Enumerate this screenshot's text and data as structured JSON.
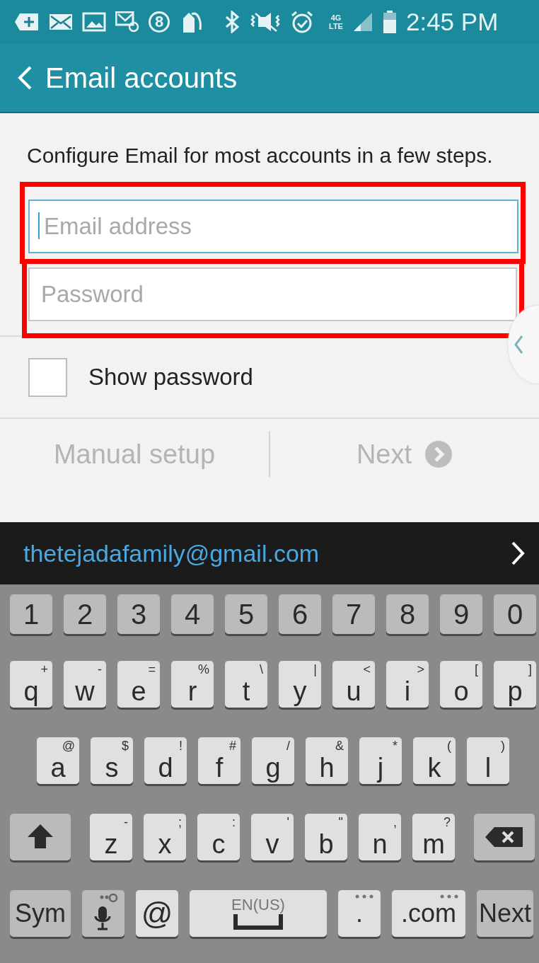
{
  "status_bar": {
    "badge": "8",
    "network_top": "4G",
    "network_bottom": "LTE",
    "time": "2:45 PM"
  },
  "app_bar": {
    "title": "Email accounts"
  },
  "description": "Configure Email for most accounts in a few steps.",
  "fields": [
    {
      "placeholder": "Email address",
      "focused": true,
      "highlighted": true
    },
    {
      "placeholder": "Password",
      "focused": false,
      "highlighted": true
    }
  ],
  "show_password": {
    "label": "Show password",
    "checked": false
  },
  "actions": [
    {
      "label": "Manual setup",
      "disabled": true,
      "kind": "text"
    },
    {
      "label": "Next",
      "disabled": true,
      "kind": "next"
    }
  ],
  "suggestion": {
    "text": "thetejadafamily@gmail.com"
  },
  "keyboard": {
    "rows": [
      {
        "keys": [
          {
            "kind": "number",
            "label": "1"
          },
          {
            "kind": "number",
            "label": "2"
          },
          {
            "kind": "number",
            "label": "3"
          },
          {
            "kind": "number",
            "label": "4"
          },
          {
            "kind": "number",
            "label": "5"
          },
          {
            "kind": "number",
            "label": "6"
          },
          {
            "kind": "number",
            "label": "7"
          },
          {
            "kind": "number",
            "label": "8"
          },
          {
            "kind": "number",
            "label": "9"
          },
          {
            "kind": "number",
            "label": "0"
          }
        ]
      },
      {
        "keys": [
          {
            "kind": "char",
            "label": "q",
            "alt": "+"
          },
          {
            "kind": "char",
            "label": "w",
            "alt": "-"
          },
          {
            "kind": "char",
            "label": "e",
            "alt": "="
          },
          {
            "kind": "char",
            "label": "r",
            "alt": "%"
          },
          {
            "kind": "char",
            "label": "t",
            "alt": "\\"
          },
          {
            "kind": "char",
            "label": "y",
            "alt": "|"
          },
          {
            "kind": "char",
            "label": "u",
            "alt": "<"
          },
          {
            "kind": "char",
            "label": "i",
            "alt": ">"
          },
          {
            "kind": "char",
            "label": "o",
            "alt": "["
          },
          {
            "kind": "char",
            "label": "p",
            "alt": "]"
          }
        ]
      },
      {
        "keys": [
          {
            "kind": "char",
            "label": "a",
            "alt": "@"
          },
          {
            "kind": "char",
            "label": "s",
            "alt": "$"
          },
          {
            "kind": "char",
            "label": "d",
            "alt": "!"
          },
          {
            "kind": "char",
            "label": "f",
            "alt": "#"
          },
          {
            "kind": "char",
            "label": "g",
            "alt": "/"
          },
          {
            "kind": "char",
            "label": "h",
            "alt": "&"
          },
          {
            "kind": "char",
            "label": "j",
            "alt": "*"
          },
          {
            "kind": "char",
            "label": "k",
            "alt": "("
          },
          {
            "kind": "char",
            "label": "l",
            "alt": ")"
          }
        ]
      },
      {
        "keys": [
          {
            "kind": "shift"
          },
          {
            "kind": "char",
            "label": "z",
            "alt": "-"
          },
          {
            "kind": "char",
            "label": "x",
            "alt": ";"
          },
          {
            "kind": "char",
            "label": "c",
            "alt": ":"
          },
          {
            "kind": "char",
            "label": "v",
            "alt": "'"
          },
          {
            "kind": "char",
            "label": "b",
            "alt": "\""
          },
          {
            "kind": "char",
            "label": "n",
            "alt": ","
          },
          {
            "kind": "char",
            "label": "m",
            "alt": "?"
          },
          {
            "kind": "backspace"
          }
        ]
      },
      {
        "keys": [
          {
            "kind": "sym",
            "label": "Sym"
          },
          {
            "kind": "mic"
          },
          {
            "kind": "at",
            "label": "@"
          },
          {
            "kind": "space",
            "label": "EN(US)"
          },
          {
            "kind": "period",
            "label": "."
          },
          {
            "kind": "dotcom",
            "label": ".com"
          },
          {
            "kind": "enter",
            "label": "Next"
          }
        ]
      }
    ]
  }
}
